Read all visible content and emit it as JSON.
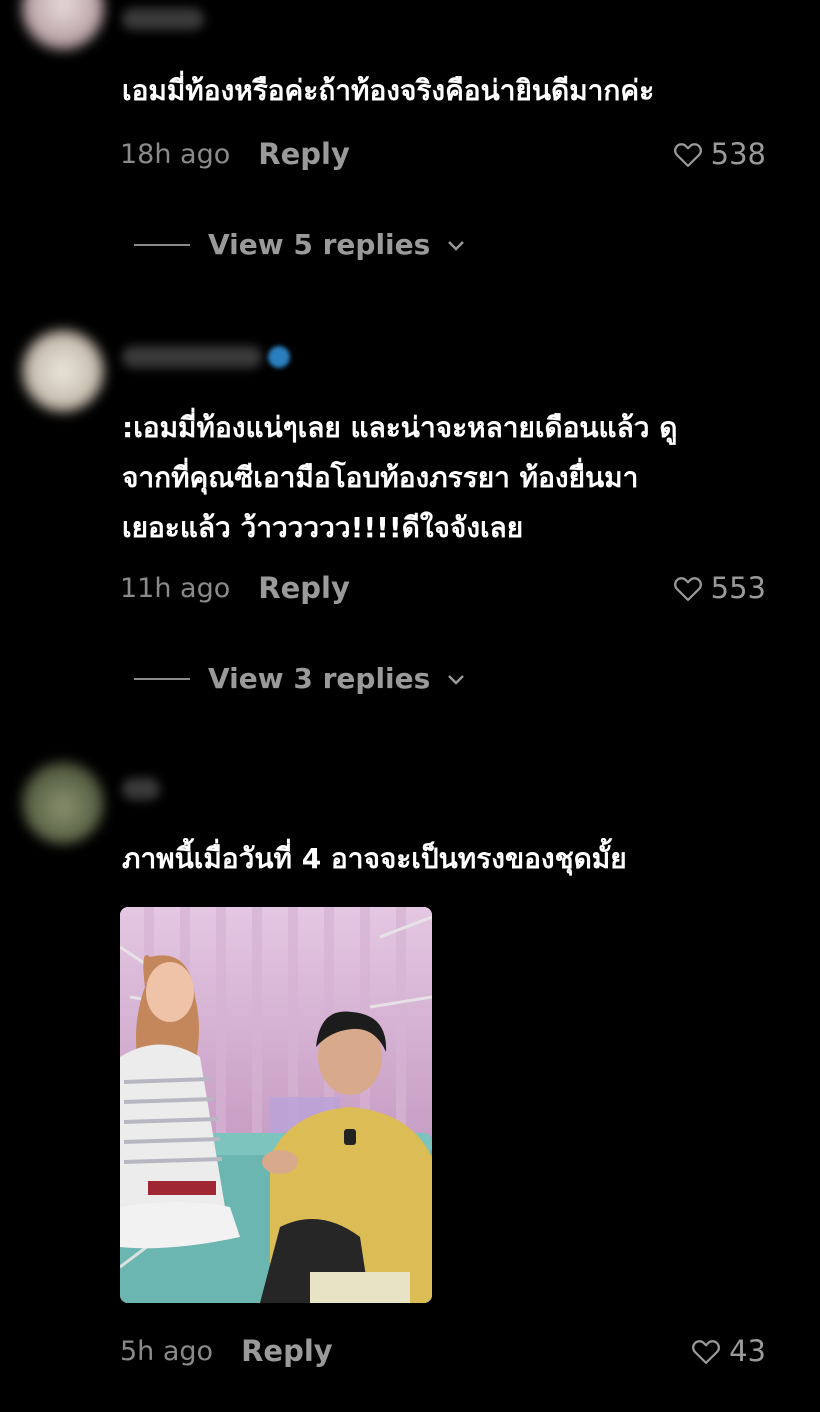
{
  "comments": [
    {
      "text": "เอมมี่ท้องหรือค่ะถ้าท้องจริงคือน่ายินดีมากค่ะ",
      "time": "18h ago",
      "reply": "Reply",
      "likes": "538",
      "view_replies": "View 5 replies"
    },
    {
      "text": ":เอมมี่ท้องแน่ๆเลย และน่าจะหลายเดือนแล้ว ดู\nจากที่คุณซีเอามือโอบท้องภรรยา ท้องยื่นมา\nเยอะแล้ว ว้าววววว!!!!ดีใจจังเลย",
      "time": "11h ago",
      "reply": "Reply",
      "likes": "553",
      "view_replies": "View 3 replies"
    },
    {
      "text": "ภาพนี้เมื่อวันที่ 4 อาจจะเป็นทรงของชุดมั้ย",
      "time": "5h ago",
      "reply": "Reply",
      "likes": "43"
    }
  ],
  "colors": {
    "background": "#000000",
    "muted": "#9a9a9a"
  },
  "icons": {
    "like": "heart-outline-icon",
    "expand": "chevron-down-icon"
  }
}
